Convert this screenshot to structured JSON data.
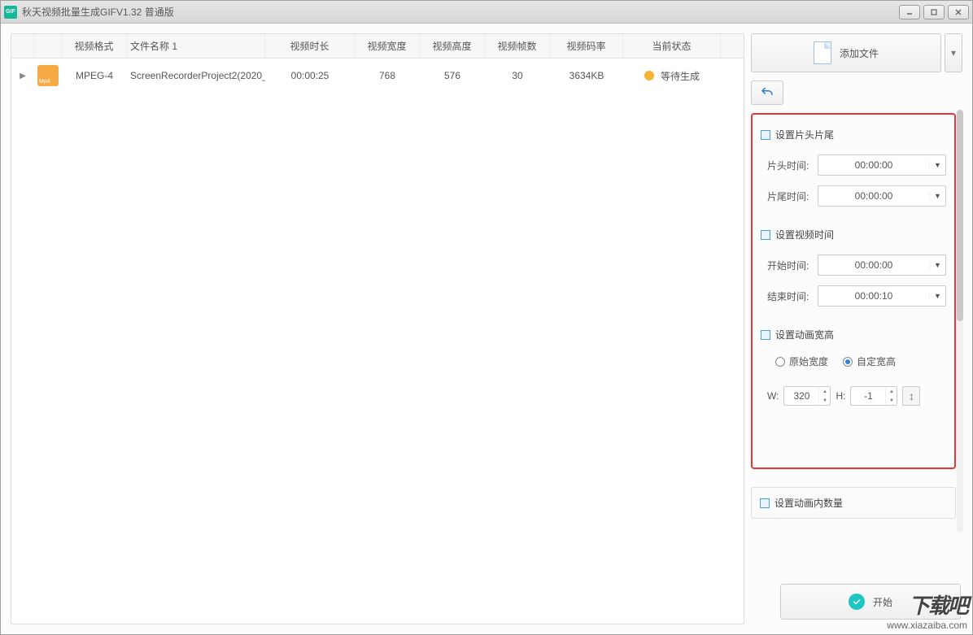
{
  "title": "秋天视频批量生成GIFV1.32 普通版",
  "grid": {
    "headers": {
      "format": "视频格式",
      "name": "文件名称 1",
      "duration": "视频时长",
      "width": "视频宽度",
      "height": "视频高度",
      "fps": "视频帧数",
      "bitrate": "视频码率",
      "status": "当前状态"
    },
    "row": {
      "format": "MPEG-4",
      "name": "ScreenRecorderProject2(2020_...",
      "duration": "00:00:25",
      "width": "768",
      "height": "576",
      "fps": "30",
      "bitrate": "3634KB",
      "status": "等待生成"
    }
  },
  "right": {
    "add_file": "添加文件",
    "section_intro": "设置片头片尾",
    "intro_start_label": "片头时间:",
    "intro_end_label": "片尾时间:",
    "intro_start": "00:00:00",
    "intro_end": "00:00:00",
    "section_time": "设置视频时间",
    "time_start_label": "开始时间:",
    "time_end_label": "结束时间:",
    "time_start": "00:00:00",
    "time_end": "00:00:10",
    "section_size": "设置动画宽高",
    "radio_original": "原始宽度",
    "radio_custom": "自定宽高",
    "w_label": "W:",
    "h_label": "H:",
    "w_val": "320",
    "h_val": "-1",
    "section_frames": "设置动画内数量",
    "start_label": "开始"
  },
  "watermark": {
    "big": "下载吧",
    "small": "www.xiazaiba.com"
  }
}
